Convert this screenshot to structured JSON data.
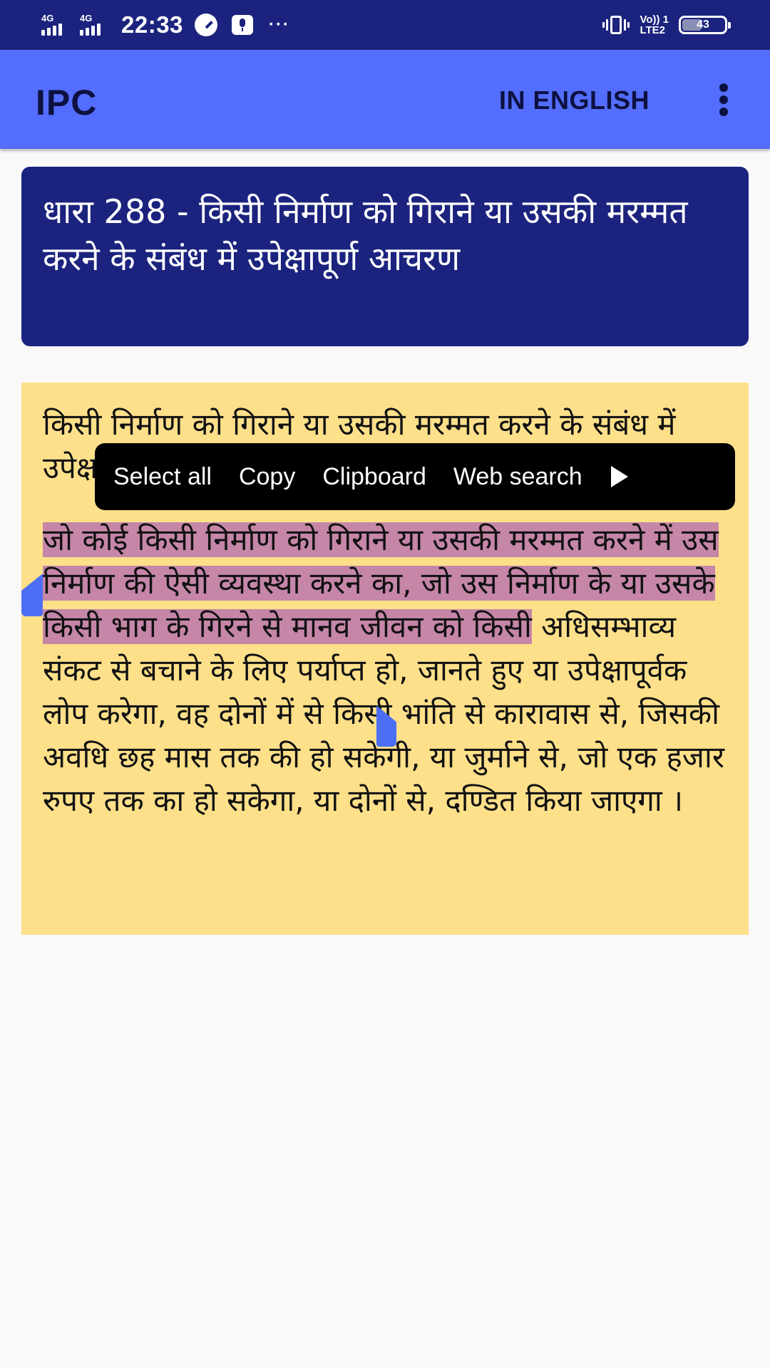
{
  "status_bar": {
    "sim1_network": "4G",
    "sim2_network": "4G",
    "time": "22:33",
    "overflow": "···",
    "volte_line1": "Vo)) 1",
    "volte_line2": "LTE2",
    "battery_level": "43",
    "battery_percent": 43
  },
  "app_bar": {
    "title": "IPC",
    "language_button": "IN ENGLISH",
    "overflow_icon": "more-vert-icon"
  },
  "section": {
    "heading": "धारा 288 - किसी निर्माण को गिराने या उसकी मरम्मत करने के संबंध में उपेक्षापूर्ण आचरण",
    "summary": "किसी निर्माण को गिराने या उसकी मरम्मत करने के संबंध में उपेक्षापूर्ण आचरण",
    "body_selected": "जो कोई किसी निर्माण को गिराने या उसकी मरम्मत करने में उस निर्माण की ऐसी व्यवस्था करने का, जो उस निर्माण के या उसके किसी भाग के गिरने से मानव जीवन को किसी",
    "body_rest": " अधिसम्भाव्य संकट से बचाने के लिए पर्याप्त हो, जानते हुए या उपेक्षापूर्वक लोप करेगा, वह दोनों में से किसी भांति से कारावास से, जिसकी अवधि छह मास तक की हो सकेगी, या जुर्माने से, जो एक हजार रुपए तक का हो सकेगा, या दोनों से, दण्डित किया जाएगा ।"
  },
  "context_menu": {
    "items": [
      "Select all",
      "Copy",
      "Clipboard",
      "Web search"
    ],
    "more_icon": "play-arrow-icon"
  },
  "colors": {
    "status_bar": "#1b237e",
    "app_bar": "#536dfe",
    "heading_card": "#1b237e",
    "body_card": "#fee08a",
    "selection": "#c586a8",
    "selection_handle": "#4c6ef5"
  }
}
